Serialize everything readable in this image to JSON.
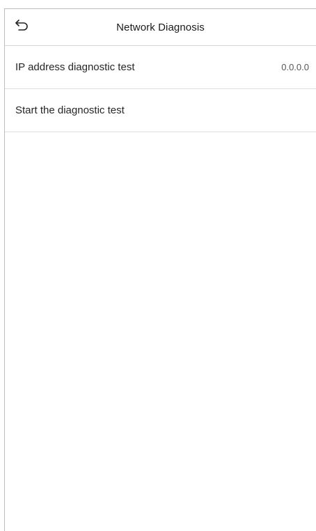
{
  "header": {
    "title": "Network Diagnosis",
    "back_icon": "back-arrow-icon"
  },
  "items": [
    {
      "label": "IP address diagnostic test",
      "value": "0.0.0.0"
    },
    {
      "label": "Start the diagnostic test",
      "value": ""
    }
  ]
}
